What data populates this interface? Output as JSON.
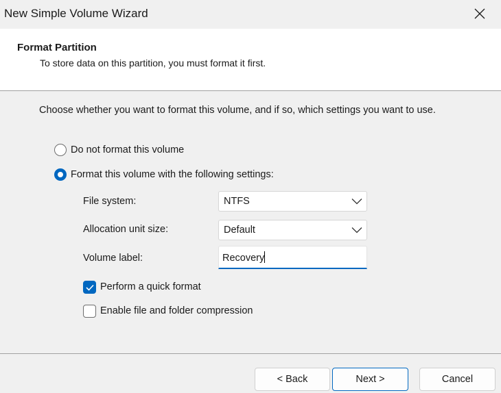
{
  "window": {
    "title": "New Simple Volume Wizard"
  },
  "header": {
    "title": "Format Partition",
    "subtitle": "To store data on this partition, you must format it first."
  },
  "instruction": "Choose whether you want to format this volume, and if so, which settings you want to use.",
  "options": {
    "no_format_label": "Do not format this volume",
    "format_label": "Format this volume with the following settings:",
    "selected": "format"
  },
  "settings": {
    "file_system_label": "File system:",
    "file_system_value": "NTFS",
    "allocation_label": "Allocation unit size:",
    "allocation_value": "Default",
    "volume_label_label": "Volume label:",
    "volume_label_value": "Recovery"
  },
  "checkboxes": {
    "quick_format_label": "Perform a quick format",
    "quick_format_checked": true,
    "compression_label": "Enable file and folder compression",
    "compression_checked": false
  },
  "buttons": {
    "back": "< Back",
    "next": "Next >",
    "cancel": "Cancel"
  },
  "colors": {
    "accent": "#0067c0",
    "background": "#f0f0f0"
  },
  "icons": {
    "close": "close-icon",
    "dropdown": "chevron-down-icon",
    "check": "checkmark-icon"
  }
}
